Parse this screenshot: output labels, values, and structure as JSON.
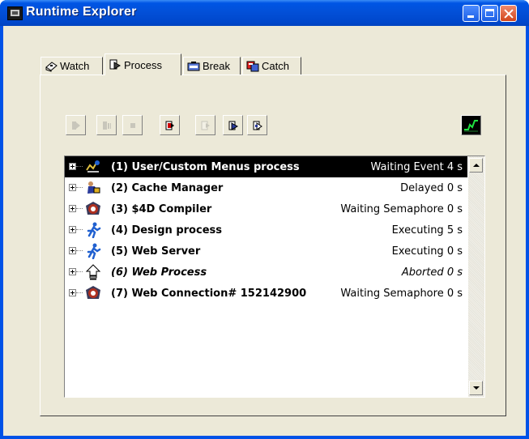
{
  "window": {
    "title": "Runtime Explorer"
  },
  "tabs": [
    {
      "label": "Watch",
      "icon": "watch-icon"
    },
    {
      "label": "Process",
      "icon": "process-icon",
      "active": true
    },
    {
      "label": "Break",
      "icon": "break-icon"
    },
    {
      "label": "Catch",
      "icon": "catch-icon"
    }
  ],
  "toolbar": {
    "buttons": [
      {
        "name": "resume-process-button",
        "icon": "resume-icon",
        "enabled": false
      },
      {
        "name": "pause-process-button",
        "icon": "pause-icon",
        "enabled": false
      },
      {
        "name": "abort-process-button",
        "icon": "stop-icon",
        "enabled": false
      },
      {
        "name": "show-process-button",
        "icon": "show-icon",
        "enabled": true
      },
      {
        "name": "hide-process-button",
        "icon": "hide-icon",
        "enabled": false
      },
      {
        "name": "trace-process-button",
        "icon": "trace-icon",
        "enabled": true
      },
      {
        "name": "debug-process-button",
        "icon": "debug-icon",
        "enabled": true
      }
    ],
    "monitor_icon": "activity-monitor-icon"
  },
  "processes": [
    {
      "name": "(1) User/Custom Menus process",
      "state": "Waiting Event  4 s",
      "icon": "user-menus-icon",
      "selected": true,
      "aborted": false
    },
    {
      "name": "(2) Cache Manager",
      "state": "Delayed  0 s",
      "icon": "cache-manager-icon",
      "selected": false,
      "aborted": false
    },
    {
      "name": "(3) $4D Compiler",
      "state": "Waiting Semaphore  0 s",
      "icon": "compiler-icon",
      "selected": false,
      "aborted": false
    },
    {
      "name": "(4) Design process",
      "state": "Executing  5 s",
      "icon": "runner-icon",
      "selected": false,
      "aborted": false
    },
    {
      "name": "(5) Web Server",
      "state": "Executing  0 s",
      "icon": "runner-icon",
      "selected": false,
      "aborted": false
    },
    {
      "name": "(6) Web Process",
      "state": "Aborted  0 s",
      "icon": "aborted-icon",
      "selected": false,
      "aborted": true
    },
    {
      "name": "(7) Web Connection# 152142900",
      "state": "Waiting Semaphore  0 s",
      "icon": "compiler-icon",
      "selected": false,
      "aborted": false
    }
  ],
  "colors": {
    "titlebar": "#0055e5",
    "selection": "#000000",
    "window_bg": "#ece9d8"
  }
}
